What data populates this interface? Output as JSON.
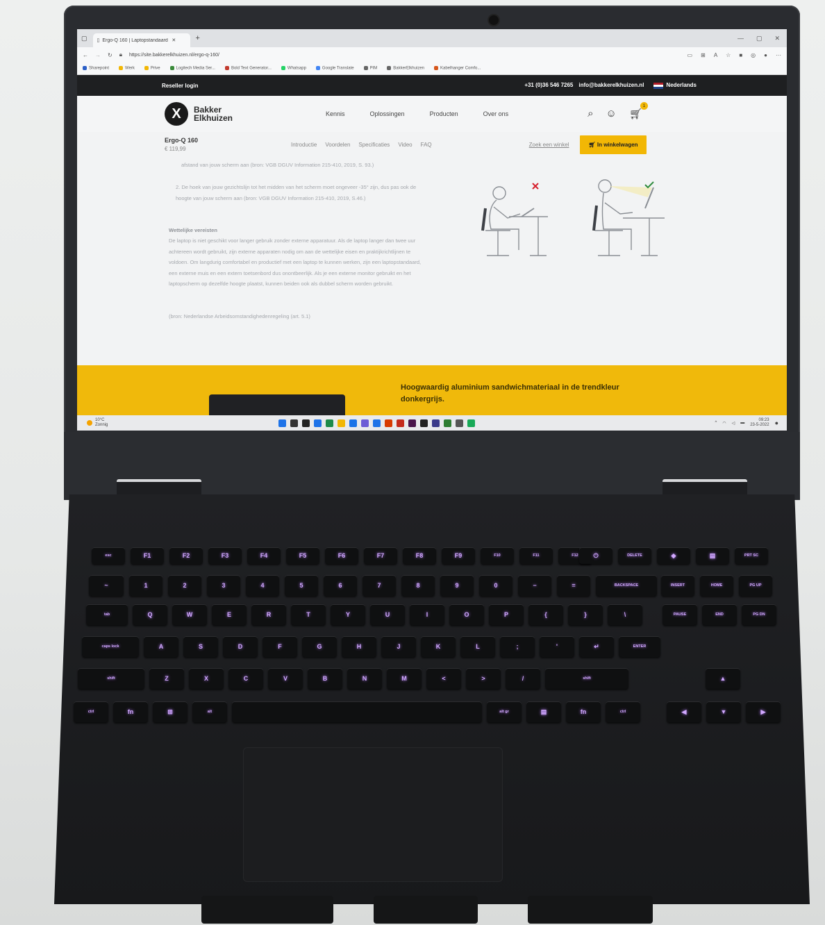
{
  "browser": {
    "tab_title": "Ergo-Q 160 | Laptopstandaard | ...",
    "url": "https://site.bakkerelkhuizen.nl/ergo-q-160/",
    "bookmarks": [
      "Sharepoint",
      "Werk",
      "Prive",
      "Logitech Media Ser...",
      "Bold Text Generator...",
      "Whatsapp",
      "Google Translate",
      "PIM",
      "BakkerElkhuizen",
      "Kabelhanger Comfo..."
    ],
    "bookmark_colors": [
      "#2b5fc7",
      "#f2b705",
      "#f2b705",
      "#3a8a3a",
      "#c23b2f",
      "#25d366",
      "#4285f4",
      "#666666",
      "#666666",
      "#d6571c"
    ]
  },
  "site": {
    "reseller_login": "Reseller login",
    "phone": "+31 (0)36 546 7265",
    "email": "info@bakkerelkhuizen.nl",
    "country": "Nederlands",
    "logo_line1": "Bakker",
    "logo_line2": "Elkhuizen",
    "nav": [
      "Kennis",
      "Oplossingen",
      "Producten",
      "Over ons"
    ],
    "cart_count": "1",
    "product_name": "Ergo-Q 160",
    "product_price": "€ 119,99",
    "subnav": [
      "Introductie",
      "Voordelen",
      "Specificaties",
      "Video",
      "FAQ"
    ],
    "store_link": "Zoek een winkel",
    "cart_button": "In winkelwagen",
    "para1": "afstand van jouw scherm aan (bron: VGB DGUV Information 215-410, 2019, S. 93.)",
    "para2": "2. De hoek van jouw gezichtslijn tot het midden van het scherm moet ongeveer -35° zijn, dus pas ook de hoogte van jouw scherm aan (bron: VGB DGUV Information 215-410, 2019, S.46.)",
    "section_title": "Wettelijke vereisten",
    "para3": "De laptop is niet geschikt voor langer gebruik zonder externe apparatuur. Als de laptop langer dan twee uur achtereen wordt gebruikt, zijn externe apparaten nodig om aan de wettelijke eisen en praktijkrichtlijnen te voldoen. Om langdurig comfortabel en productief met een laptop te kunnen werken, zijn een laptopstandaard, een externe muis en een extern toetsenbord dus onontbeerlijk. Als je een externe monitor gebruikt en het laptopscherm op dezelfde hoogte plaatst, kunnen beiden ook als dubbel scherm worden gebruikt.",
    "para4": "(bron: Nederlandse Arbeidsomstandighedenregeling (art. 5.1)",
    "band_text": "Hoogwaardig aluminium sandwichmateriaal in de trendkleur donkergrijs."
  },
  "taskbar": {
    "weather_temp": "10°C",
    "weather_desc": "Zonnig",
    "time": "09:23",
    "date": "23-5-2022",
    "icon_colors": [
      "#1e73e8",
      "#333333",
      "#222222",
      "#1e73e8",
      "#1e8a4a",
      "#f2b705",
      "#1a73e8",
      "#6b5bd6",
      "#1e73e8",
      "#d83b01",
      "#c42b1c",
      "#4a154b",
      "#222222",
      "#3a3a8a",
      "#2e7d32",
      "#555555",
      "#18a957"
    ]
  },
  "keyboard": {
    "row0": [
      "esc",
      "F1",
      "F2",
      "F3",
      "F4",
      "F5",
      "F6",
      "F7",
      "F8",
      "F9",
      "F10",
      "F11",
      "F12",
      "⏻",
      "DELETE",
      "◆",
      "▤",
      "PRT SC"
    ],
    "row1": [
      "~",
      "1",
      "2",
      "3",
      "4",
      "5",
      "6",
      "7",
      "8",
      "9",
      "0",
      "−",
      "=",
      "BACKSPACE",
      "INSERT",
      "HOME",
      "PG UP"
    ],
    "row2": [
      "tab",
      "Q",
      "W",
      "E",
      "R",
      "T",
      "Y",
      "U",
      "I",
      "O",
      "P",
      "{",
      "}",
      "\\",
      "PAUSE",
      "END",
      "PG DN"
    ],
    "row3": [
      "caps lock",
      "A",
      "S",
      "D",
      "F",
      "G",
      "H",
      "J",
      "K",
      "L",
      ";",
      "'",
      "↵",
      "ENTER"
    ],
    "row4": [
      "shift",
      "Z",
      "X",
      "C",
      "V",
      "B",
      "N",
      "M",
      "<",
      ">",
      "/",
      "shift",
      "▲"
    ],
    "row5": [
      "ctrl",
      "fn",
      "⊞",
      "alt",
      "",
      "alt gr",
      "▤",
      "fn",
      "ctrl",
      "◀",
      "▼",
      "▶"
    ]
  }
}
